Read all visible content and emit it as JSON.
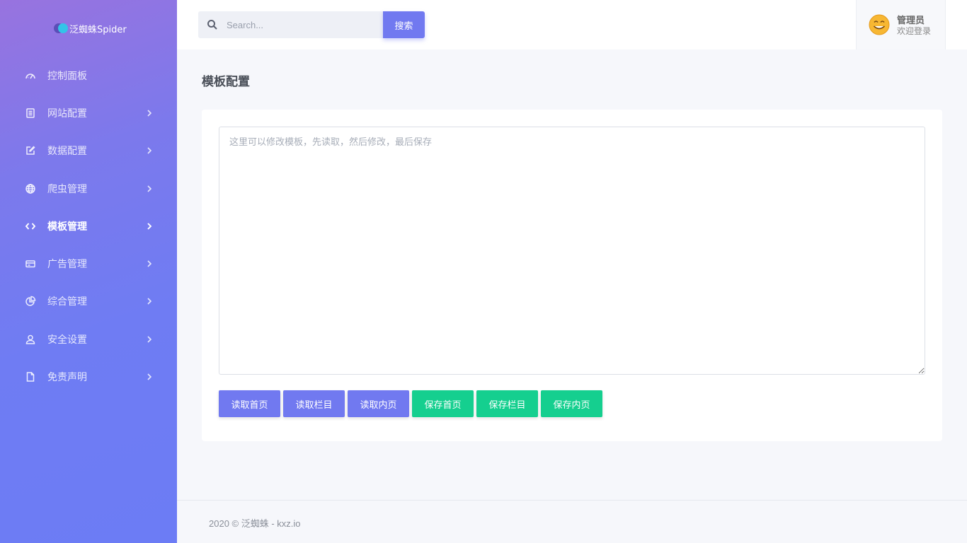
{
  "brand": {
    "name": "泛蜘蛛Spider"
  },
  "sidebar": {
    "items": [
      {
        "label": "控制面板",
        "icon": "dashboard-icon",
        "has_chevron": false
      },
      {
        "label": "网站配置",
        "icon": "document-icon",
        "has_chevron": true
      },
      {
        "label": "数据配置",
        "icon": "edit-icon",
        "has_chevron": true
      },
      {
        "label": "爬虫管理",
        "icon": "globe-icon",
        "has_chevron": true
      },
      {
        "label": "模板管理",
        "icon": "code-icon",
        "has_chevron": true,
        "active": true
      },
      {
        "label": "广告管理",
        "icon": "credit-card-icon",
        "has_chevron": true
      },
      {
        "label": "综合管理",
        "icon": "pie-chart-icon",
        "has_chevron": true
      },
      {
        "label": "安全设置",
        "icon": "user-icon",
        "has_chevron": true
      },
      {
        "label": "免责声明",
        "icon": "file-icon",
        "has_chevron": true
      }
    ]
  },
  "search": {
    "placeholder": "Search...",
    "button_label": "搜索"
  },
  "user": {
    "name": "管理员",
    "subtitle": "欢迎登录"
  },
  "page": {
    "title": "模板配置"
  },
  "editor": {
    "placeholder": "这里可以修改模板，先读取，然后修改，最后保存",
    "value": ""
  },
  "buttons": [
    {
      "label": "读取首页",
      "style": "primary"
    },
    {
      "label": "读取栏目",
      "style": "primary"
    },
    {
      "label": "读取内页",
      "style": "primary"
    },
    {
      "label": "保存首页",
      "style": "success"
    },
    {
      "label": "保存栏目",
      "style": "success"
    },
    {
      "label": "保存内页",
      "style": "success"
    }
  ],
  "footer": {
    "text": "2020 © 泛蜘蛛 - kxz.io"
  },
  "colors": {
    "primary": "#7179f0",
    "success": "#15cf8f",
    "sidebar_top": "#9873df",
    "sidebar_bottom": "#6c7cf5"
  }
}
